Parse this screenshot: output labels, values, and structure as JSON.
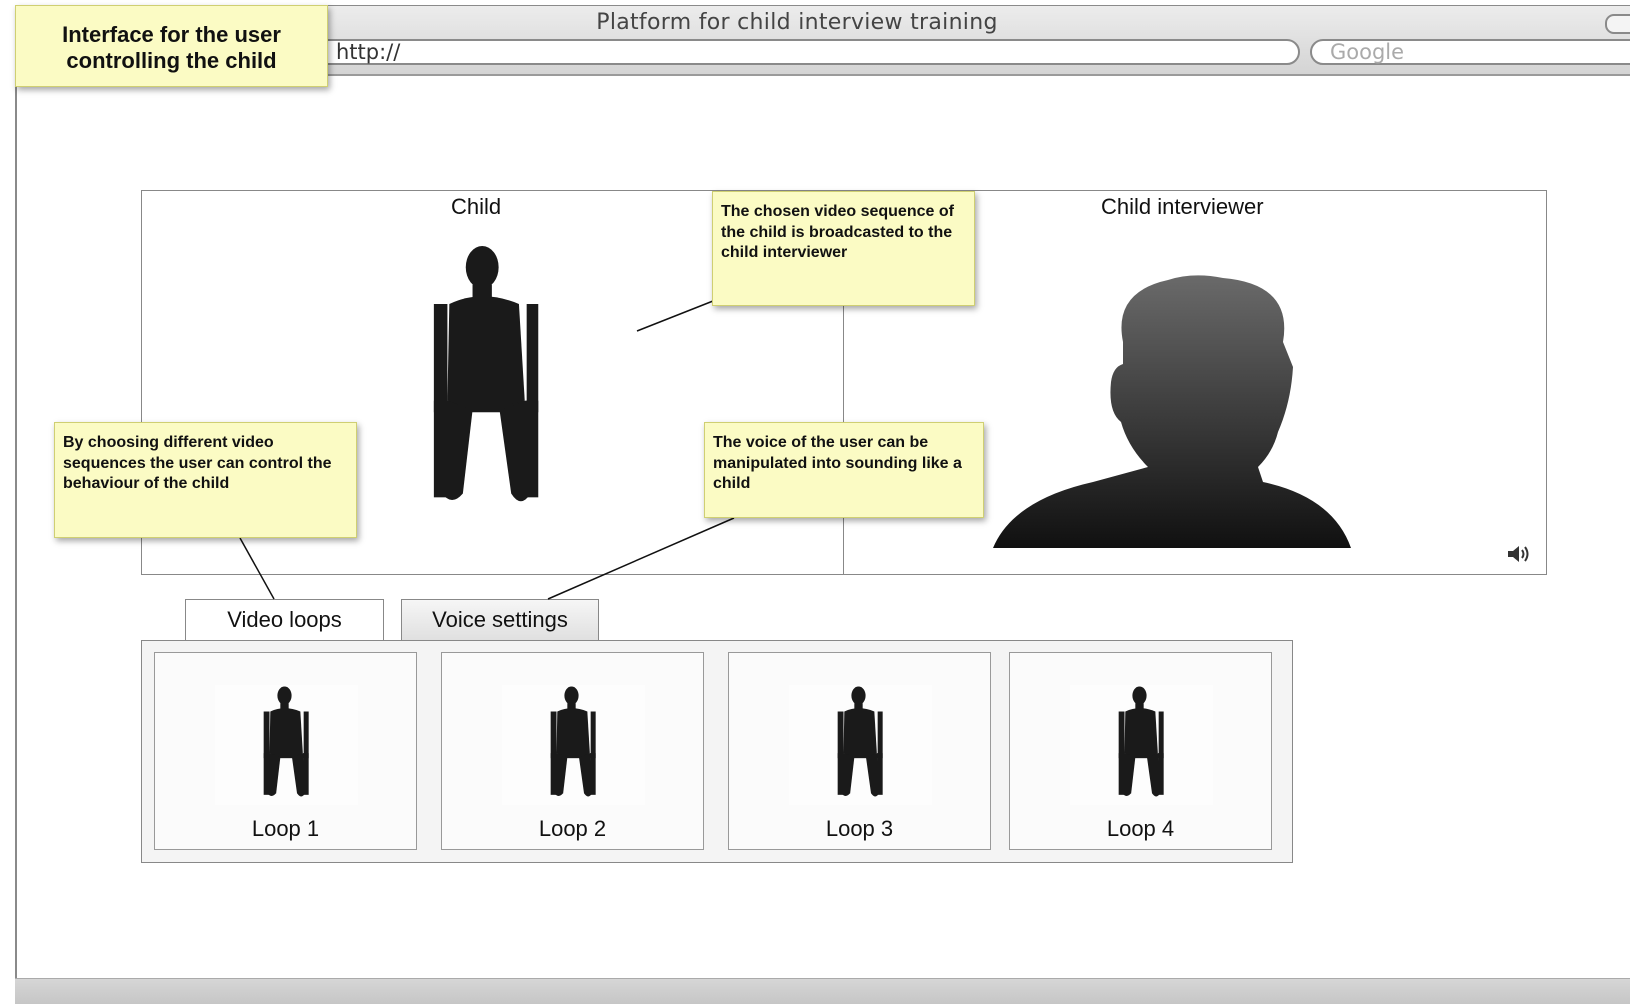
{
  "window": {
    "title": "Platform for child interview training",
    "url_value": "http://",
    "search_placeholder": "Google"
  },
  "notes": {
    "main": "Interface for the user controlling the child",
    "video_broadcast": "The chosen video sequence of the child is broadcasted to the child interviewer",
    "voice": "The voice of the user can be manipulated into sounding like a child",
    "behaviour": "By choosing different video sequences the user can control the behaviour of the child"
  },
  "video": {
    "child_label": "Child",
    "interviewer_label": "Child interviewer"
  },
  "icons": {
    "speaker": "speaker-icon",
    "child": "child-silhouette-icon",
    "interviewer": "head-silhouette-icon"
  },
  "tabs": [
    {
      "label": "Video loops",
      "active": true
    },
    {
      "label": "Voice settings",
      "active": false
    }
  ],
  "loops": [
    {
      "label": "Loop 1"
    },
    {
      "label": "Loop 2"
    },
    {
      "label": "Loop 3"
    },
    {
      "label": "Loop 4"
    }
  ],
  "colors": {
    "note_bg": "#fbfbc4",
    "silhouette": "#1a1a1a"
  }
}
